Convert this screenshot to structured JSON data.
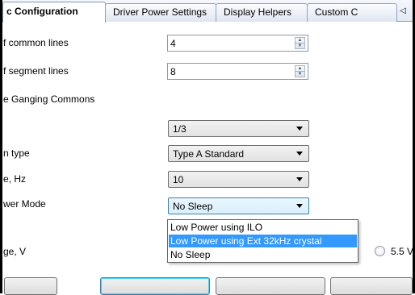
{
  "tabs": [
    {
      "label": "c Configuration",
      "active": true
    },
    {
      "label": "Driver Power Settings",
      "active": false
    },
    {
      "label": "Display Helpers",
      "active": false
    },
    {
      "label": "Custom C",
      "active": false
    }
  ],
  "tab_scroll_glyph": "◁",
  "fields": {
    "common_lines": {
      "label": "f common lines",
      "value": "4"
    },
    "segment_lines": {
      "label": "f segment lines",
      "value": "8"
    },
    "ganging": {
      "label": "e Ganging Commons"
    },
    "bias": {
      "label": "",
      "value": "1/3"
    },
    "waveform_type": {
      "label": "n type",
      "value": "Type A Standard"
    },
    "frame_rate": {
      "label": "e, Hz",
      "value": "10"
    },
    "power_mode": {
      "label": "wer Mode",
      "value": "No Sleep"
    },
    "voltage": {
      "label": "ge, V",
      "radio_label": "5.5 V"
    }
  },
  "power_mode_options": [
    {
      "label": "Low Power using ILO",
      "selected": false
    },
    {
      "label": "Low Power using Ext 32kHz crystal",
      "selected": true
    },
    {
      "label": "No Sleep",
      "selected": false
    }
  ],
  "spin_up_glyph": "▲",
  "spin_down_glyph": "▼",
  "colors": {
    "selection": "#3399ff",
    "tab_border": "#8da2c4",
    "focus_border": "#3c7fb1"
  }
}
